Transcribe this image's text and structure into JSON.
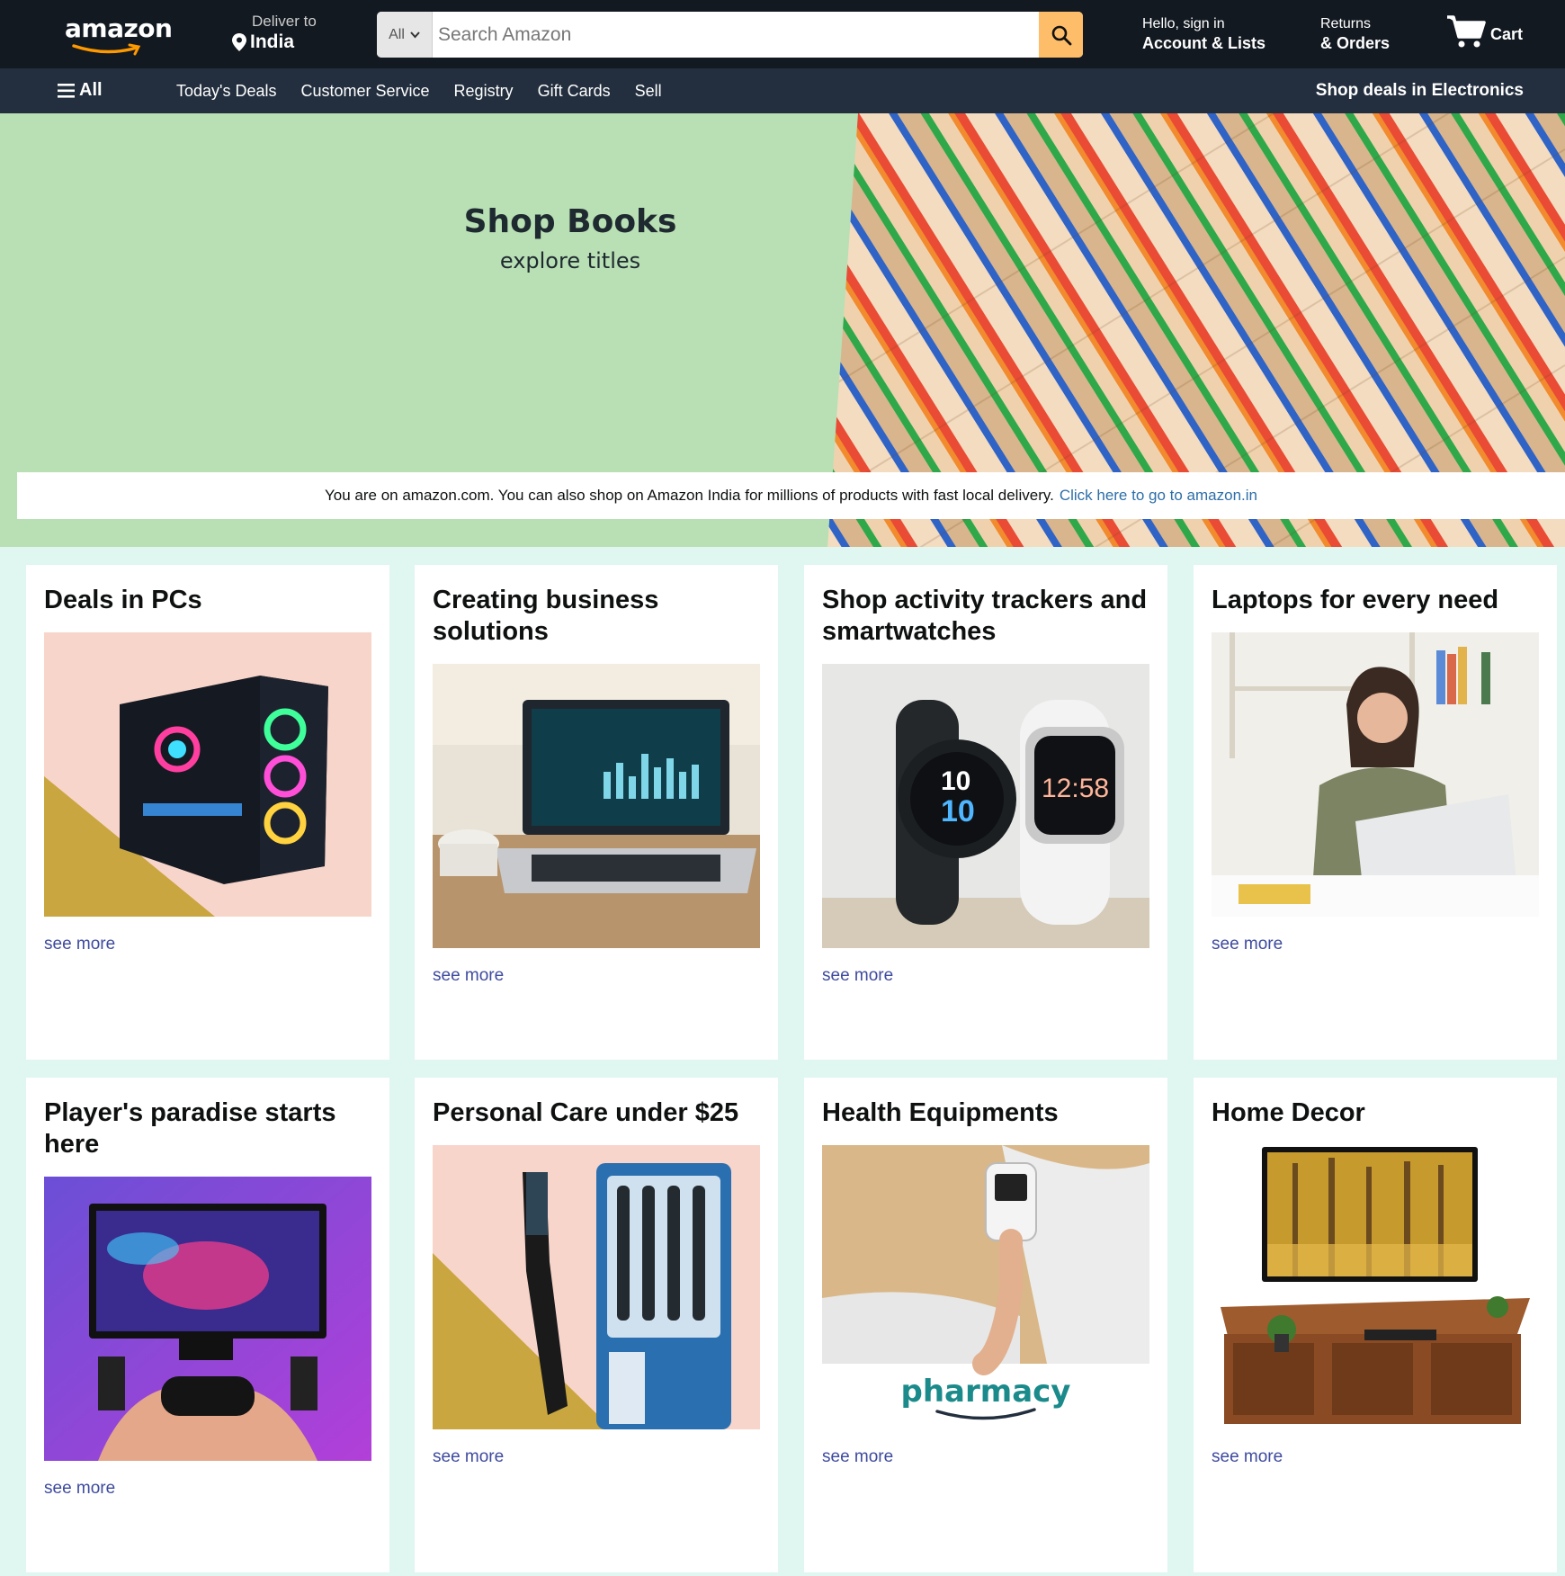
{
  "header": {
    "logo_text": "amazon",
    "deliver_label": "Deliver to",
    "deliver_location": "India",
    "search_category": "All",
    "search_placeholder": "Search Amazon",
    "account_line1": "Hello, sign in",
    "account_line2": "Account & Lists",
    "returns_line1": "Returns",
    "returns_line2": "& Orders",
    "cart_label": "Cart"
  },
  "subnav": {
    "all_label": "All",
    "links": [
      "Today's Deals",
      "Customer Service",
      "Registry",
      "Gift Cards",
      "Sell"
    ],
    "promo": "Shop deals in Electronics"
  },
  "hero": {
    "title": "Shop Books",
    "subtitle": "explore titles"
  },
  "notice": {
    "text": "You are on amazon.com. You can also shop on Amazon India for millions of products with fast local delivery.",
    "link": "Click here to go to amazon.in"
  },
  "cards": [
    {
      "title": "Deals in PCs",
      "link": "see more"
    },
    {
      "title": "Creating business solutions",
      "link": "see more"
    },
    {
      "title": "Shop activity trackers and smartwatches",
      "link": "see more"
    },
    {
      "title": "Laptops for every need",
      "link": "see more"
    },
    {
      "title": "Player's paradise starts here",
      "link": "see more"
    },
    {
      "title": "Personal Care under $25",
      "link": "see more"
    },
    {
      "title": "Health Equipments",
      "link": "see more",
      "image_text": "pharmacy"
    },
    {
      "title": "Home Decor",
      "link": "see more"
    }
  ],
  "product_text": {
    "watch_time_1": "10",
    "watch_time_2": "10",
    "watch_time_3": "12:58"
  },
  "colors": {
    "nav_dark": "#131921",
    "nav_sub": "#232f3e",
    "search_button": "#febd69",
    "hero_green": "#b9dfb4",
    "page_bg": "#dff6f1",
    "link_blue": "#2e6fa8"
  }
}
